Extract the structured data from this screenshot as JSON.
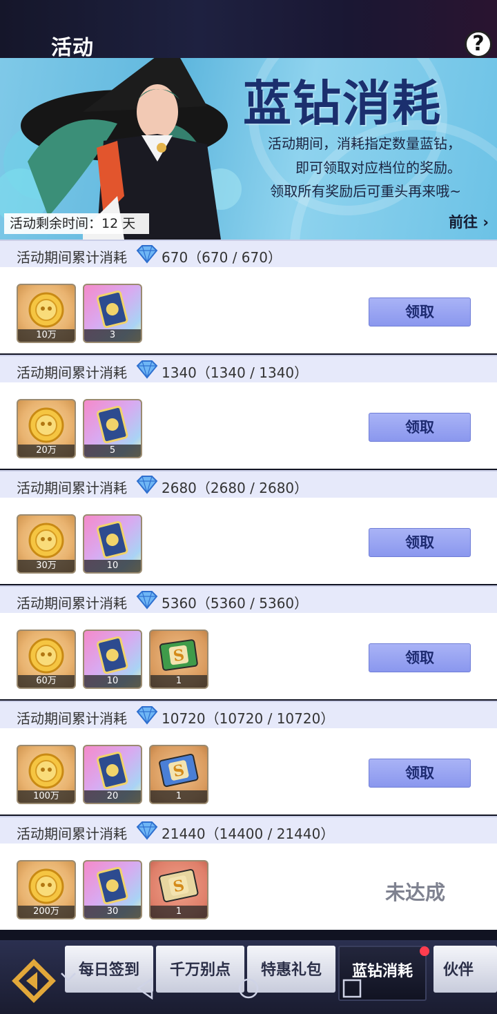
{
  "header": {
    "title": "活动",
    "help_symbol": "?"
  },
  "banner": {
    "heading": "蓝钻消耗",
    "desc_lines": [
      "活动期间，消耗指定数量蓝钻，",
      "即可领取对应档位的奖励。",
      "领取所有奖励后可重头再来哦~"
    ],
    "remaining": "活动剩余时间：12 天",
    "goto": "前往"
  },
  "tiers": [
    {
      "label": "活动期间累计消耗",
      "amount": "670（670 / 670）",
      "items": [
        {
          "icon": "gold-coin-icon",
          "qty": "10万"
        },
        {
          "icon": "card-icon",
          "qty": "3"
        }
      ],
      "action": "领取",
      "status": "claimable"
    },
    {
      "label": "活动期间累计消耗",
      "amount": "1340（1340 / 1340）",
      "items": [
        {
          "icon": "gold-coin-icon",
          "qty": "20万"
        },
        {
          "icon": "card-icon",
          "qty": "5"
        }
      ],
      "action": "领取",
      "status": "claimable"
    },
    {
      "label": "活动期间累计消耗",
      "amount": "2680（2680 / 2680）",
      "items": [
        {
          "icon": "gold-coin-icon",
          "qty": "30万"
        },
        {
          "icon": "card-icon",
          "qty": "10"
        }
      ],
      "action": "领取",
      "status": "claimable"
    },
    {
      "label": "活动期间累计消耗",
      "amount": "5360（5360 / 5360）",
      "items": [
        {
          "icon": "gold-coin-icon",
          "qty": "60万"
        },
        {
          "icon": "card-icon",
          "qty": "10"
        },
        {
          "icon": "skill-book-green-icon",
          "qty": "1"
        }
      ],
      "action": "领取",
      "status": "claimable"
    },
    {
      "label": "活动期间累计消耗",
      "amount": "10720（10720 / 10720）",
      "items": [
        {
          "icon": "gold-coin-icon",
          "qty": "100万"
        },
        {
          "icon": "card-icon",
          "qty": "20"
        },
        {
          "icon": "skill-book-blue-icon",
          "qty": "1"
        }
      ],
      "action": "领取",
      "status": "claimable"
    },
    {
      "label": "活动期间累计消耗",
      "amount": "21440（14400 / 21440）",
      "items": [
        {
          "icon": "gold-coin-icon",
          "qty": "200万"
        },
        {
          "icon": "card-icon",
          "qty": "30"
        },
        {
          "icon": "skill-book-rainbow-icon",
          "qty": "1"
        }
      ],
      "action": "未达成",
      "status": "locked"
    }
  ],
  "tabs": [
    {
      "label": "每日签到",
      "active": false
    },
    {
      "label": "千万别点",
      "active": false
    },
    {
      "label": "特惠礼包",
      "active": false
    },
    {
      "label": "蓝钻消耗",
      "active": true
    },
    {
      "label": "伙伴",
      "active": false
    }
  ],
  "colors": {
    "accent": "#8a97ee",
    "header_bg": "#e6e9fa",
    "badge": "#ff3d4f"
  }
}
